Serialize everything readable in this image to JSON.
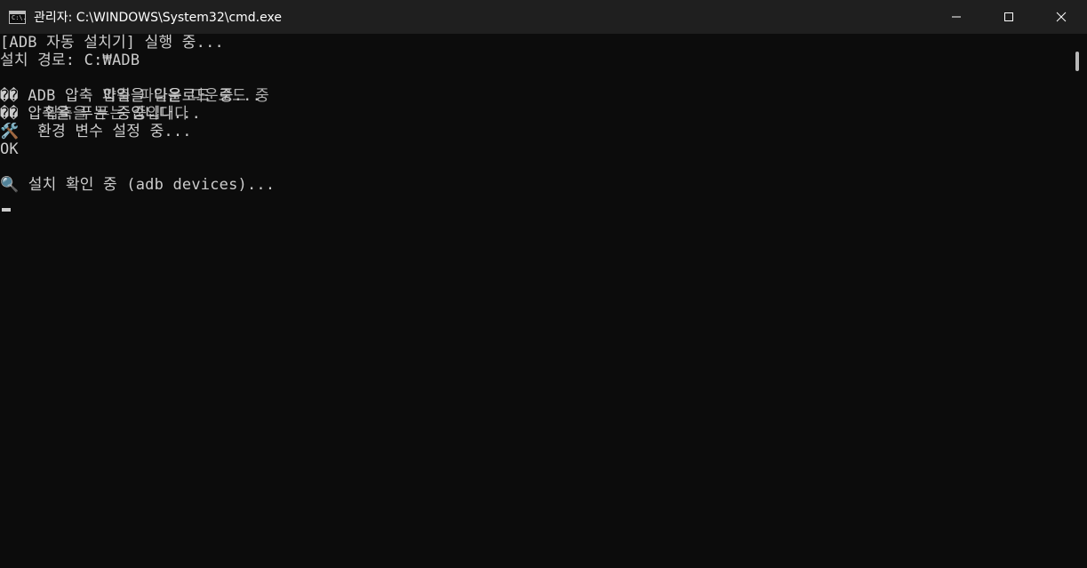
{
  "window": {
    "title": "관리자: C:\\WINDOWS\\System32\\cmd.exe",
    "icon_text": "C:\\.",
    "controls": {
      "minimize": "minimize-icon",
      "maximize": "maximize-icon",
      "close": "close-icon"
    }
  },
  "console": {
    "lines": [
      "[ADB 자동 설치기] 실행 중...",
      "설치 경로: C:₩ADB",
      "",
      "�� ADB 압축 파일을 다운로드 중...",
      "�� 압축을 푸는 중입니다...",
      "🛠️  환경 변수 설정 중...",
      "OK",
      "",
      "🔍 설치 확인 중 (adb devices)..."
    ],
    "garbled_overlays": [
      "       압축 파일을 다운로드 중",
      "   압축을 푸는 중입니다"
    ]
  },
  "colors": {
    "background": "#0c0c0c",
    "titlebar": "#1f1f1f",
    "text": "#cccccc"
  }
}
